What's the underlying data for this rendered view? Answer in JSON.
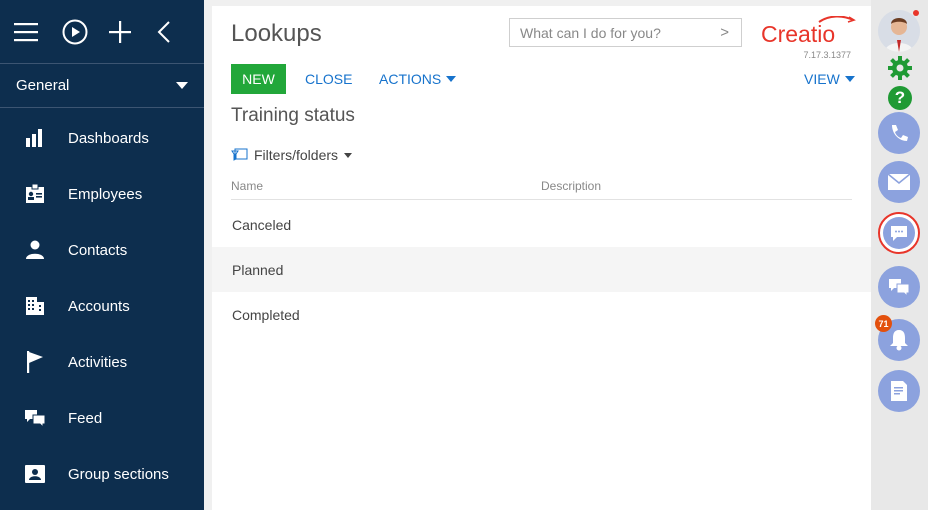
{
  "sidebar": {
    "workplace": "General",
    "items": [
      {
        "label": "Dashboards",
        "icon": "bar-chart-icon"
      },
      {
        "label": "Employees",
        "icon": "employee-badge-icon"
      },
      {
        "label": "Contacts",
        "icon": "person-icon"
      },
      {
        "label": "Accounts",
        "icon": "building-icon"
      },
      {
        "label": "Activities",
        "icon": "flag-icon"
      },
      {
        "label": "Feed",
        "icon": "chat-bubbles-icon"
      },
      {
        "label": "Group sections",
        "icon": "group-card-icon"
      }
    ]
  },
  "main": {
    "title": "Lookups",
    "search_placeholder": "What can I do for you?",
    "logo_text": "Creatio",
    "version": "7.17.3.1377",
    "new_label": "NEW",
    "close_label": "CLOSE",
    "actions_label": "ACTIONS",
    "view_label": "VIEW",
    "subtitle": "Training status",
    "filters_label": "Filters/folders",
    "columns": {
      "name": "Name",
      "description": "Description"
    },
    "rows": [
      {
        "name": "Canceled",
        "description": ""
      },
      {
        "name": "Planned",
        "description": ""
      },
      {
        "name": "Completed",
        "description": ""
      }
    ]
  },
  "right_panel": {
    "notification_count": "71"
  },
  "colors": {
    "sidebar": "#0d2e4e",
    "new_button": "#22a73a",
    "link": "#1773cc",
    "logo": "#e8352a",
    "panel_button": "#8ca2de"
  }
}
